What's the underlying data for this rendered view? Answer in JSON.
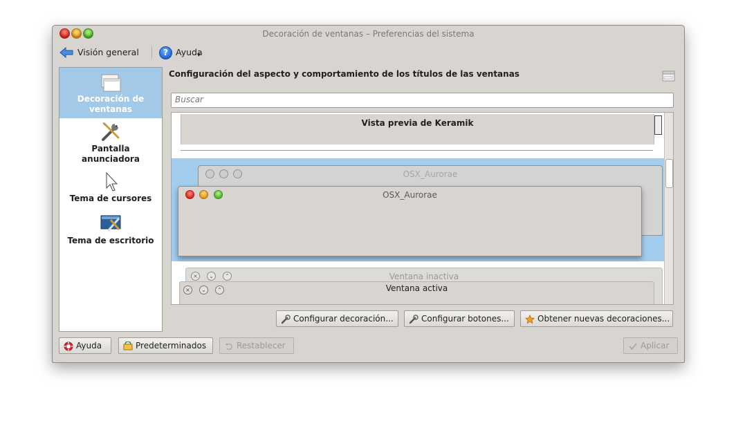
{
  "window": {
    "title": "Decoración de ventanas – Preferencias del sistema"
  },
  "toolbar": {
    "back_label": "Visión general",
    "help_label": "Ayuda",
    "help_glyph": "?"
  },
  "sidebar": {
    "items": [
      {
        "label": "Decoración de ventanas",
        "icon": "window-decoration-icon",
        "selected": true
      },
      {
        "label": "Pantalla anunciadora",
        "icon": "tools-icon",
        "selected": false
      },
      {
        "label": "Tema de cursores",
        "icon": "cursor-icon",
        "selected": false
      },
      {
        "label": "Tema de escritorio",
        "icon": "desktop-theme-icon",
        "selected": false
      }
    ]
  },
  "main": {
    "title": "Configuración del aspecto y comportamiento de los títulos de las ventanas",
    "search_placeholder": "Buscar",
    "previews": [
      {
        "label": "Vista previa de Keramik"
      },
      {
        "inactive_title": "OSX_Aurorae",
        "active_title": "OSX_Aurorae"
      },
      {
        "inactive_title": "Ventana inactiva",
        "active_title": "Ventana activa"
      }
    ],
    "buttons": {
      "configure_decoration": "Configurar decoración...",
      "configure_buttons": "Configurar botones...",
      "get_new": "Obtener nuevas decoraciones..."
    }
  },
  "footer": {
    "help": "Ayuda",
    "defaults": "Predeterminados",
    "reset": "Restablecer",
    "apply": "Aplicar"
  },
  "colors": {
    "window_bg": "#d8d5d1",
    "selection": "#a3c9e8",
    "preview_highlight": "#a3cdee"
  }
}
